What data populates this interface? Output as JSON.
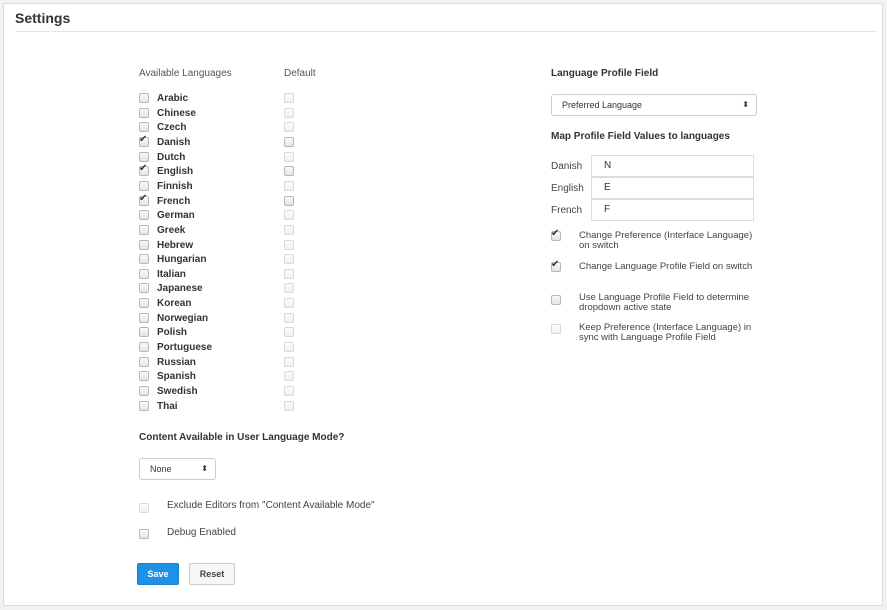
{
  "header": {
    "title": "Settings"
  },
  "languages_section": {
    "col_available": "Available Languages",
    "col_default": "Default",
    "languages": [
      {
        "label": "Arabic",
        "available": false,
        "default": false
      },
      {
        "label": "Chinese",
        "available": false,
        "default": false
      },
      {
        "label": "Czech",
        "available": false,
        "default": false
      },
      {
        "label": "Danish",
        "available": true,
        "default": false
      },
      {
        "label": "Dutch",
        "available": false,
        "default": false
      },
      {
        "label": "English",
        "available": true,
        "default": false
      },
      {
        "label": "Finnish",
        "available": false,
        "default": false
      },
      {
        "label": "French",
        "available": true,
        "default": false
      },
      {
        "label": "German",
        "available": false,
        "default": false
      },
      {
        "label": "Greek",
        "available": false,
        "default": false
      },
      {
        "label": "Hebrew",
        "available": false,
        "default": false
      },
      {
        "label": "Hungarian",
        "available": false,
        "default": false
      },
      {
        "label": "Italian",
        "available": false,
        "default": false
      },
      {
        "label": "Japanese",
        "available": false,
        "default": false
      },
      {
        "label": "Korean",
        "available": false,
        "default": false
      },
      {
        "label": "Norwegian",
        "available": false,
        "default": false
      },
      {
        "label": "Polish",
        "available": false,
        "default": false
      },
      {
        "label": "Portuguese",
        "available": false,
        "default": false
      },
      {
        "label": "Russian",
        "available": false,
        "default": false
      },
      {
        "label": "Spanish",
        "available": false,
        "default": false
      },
      {
        "label": "Swedish",
        "available": false,
        "default": false
      },
      {
        "label": "Thai",
        "available": false,
        "default": false
      }
    ]
  },
  "content_mode": {
    "heading": "Content Available in User Language Mode?",
    "select_value": "None",
    "exclude_editors_label": "Exclude Editors from \"Content Available Mode\"",
    "exclude_editors_checked": false,
    "debug_label": "Debug Enabled",
    "debug_checked": false
  },
  "profile_field": {
    "heading": "Language Profile Field",
    "select_value": "Preferred Language",
    "map_heading": "Map Profile Field Values to languages",
    "mappings": [
      {
        "language": "Danish",
        "value": "N"
      },
      {
        "language": "English",
        "value": "E"
      },
      {
        "language": "French",
        "value": "F"
      }
    ],
    "options": [
      {
        "label": "Change Preference (Interface Language) on switch",
        "checked": true
      },
      {
        "label": "Change Language Profile Field on switch",
        "checked": true
      },
      {
        "label": "Use Language Profile Field to determine dropdown active state",
        "checked": false
      },
      {
        "label": "Keep Preference (Interface Language) in sync with Language Profile Field",
        "checked": false
      }
    ]
  },
  "actions": {
    "save_label": "Save",
    "reset_label": "Reset"
  },
  "icons": {
    "select_arrows": "updown-caret-icon",
    "checkbox_tick": "check-icon"
  }
}
